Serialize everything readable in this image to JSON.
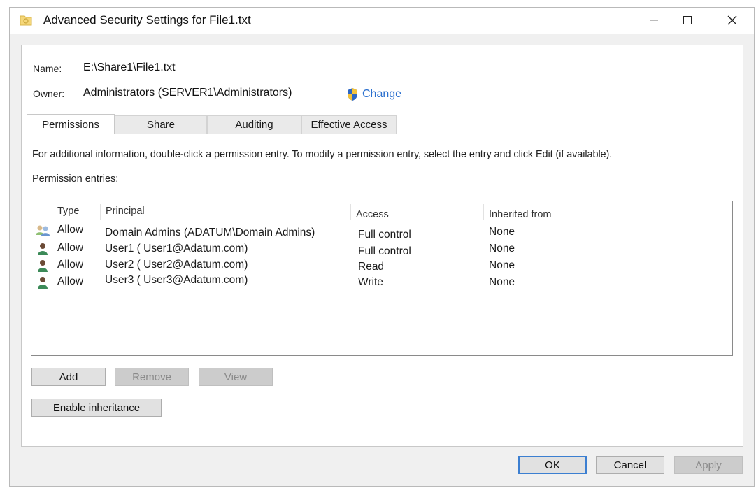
{
  "window": {
    "title": "Advanced Security Settings for File1.txt",
    "icon": "folder-lock-icon",
    "controls": {
      "minimize": "minimize-icon",
      "maximize": "maximize-icon",
      "close": "close-icon"
    }
  },
  "header": {
    "name_label": "Name:",
    "name_value": "E:\\Share1\\File1.txt",
    "owner_label": "Owner:",
    "owner_value": "Administrators (SERVER1\\Administrators)",
    "change_label": "Change",
    "change_icon": "uac-shield-icon"
  },
  "tabs": [
    {
      "label": "Permissions",
      "active": true
    },
    {
      "label": "Share",
      "active": false
    },
    {
      "label": "Auditing",
      "active": false
    },
    {
      "label": "Effective Access",
      "active": false
    }
  ],
  "permissions": {
    "info_text": "For additional information, double-click a permission entry. To modify a permission entry, select the entry and click Edit (if available).",
    "entries_label": "Permission entries:",
    "columns": [
      "Type",
      "Principal",
      "Access",
      "Inherited from"
    ],
    "rows": [
      {
        "icon": "group-icon",
        "type": "Allow",
        "principal": "Domain Admins (ADATUM\\Domain Admins)",
        "access": "Full control",
        "inherited_from": "None"
      },
      {
        "icon": "user-icon",
        "type": "Allow",
        "principal": "User1 ( User1@Adatum.com)",
        "access": "Full control",
        "inherited_from": "None"
      },
      {
        "icon": "user-icon",
        "type": "Allow",
        "principal": "User2 ( User2@Adatum.com)",
        "access": "Read",
        "inherited_from": "None"
      },
      {
        "icon": "user-icon",
        "type": "Allow",
        "principal": "User3 ( User3@Adatum.com)",
        "access": "Write",
        "inherited_from": "None"
      }
    ],
    "buttons": {
      "add": "Add",
      "remove": "Remove",
      "view": "View",
      "enable_inheritance": "Enable inheritance"
    }
  },
  "footer": {
    "ok": "OK",
    "cancel": "Cancel",
    "apply": "Apply"
  },
  "colors": {
    "link": "#2a6fce",
    "default_button_border": "#3c7fd1",
    "dialog_background": "#f0f0f0"
  }
}
